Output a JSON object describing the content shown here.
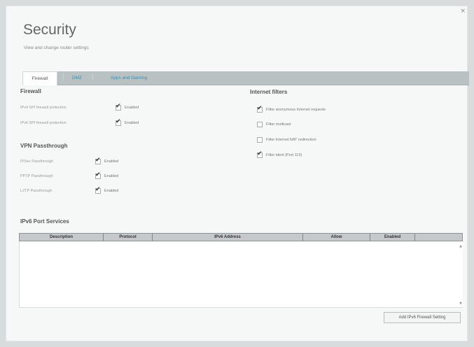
{
  "window": {
    "close_glyph": "×"
  },
  "page": {
    "title": "Security",
    "subtitle": "View and change router settings"
  },
  "tabs": [
    {
      "label": "Firewall",
      "active": true
    },
    {
      "label": "DMZ",
      "active": false
    },
    {
      "label": "Apps and Gaming",
      "active": false
    }
  ],
  "firewall": {
    "title": "Firewall",
    "rows": [
      {
        "label": "IPv4 SPI firewall protection",
        "checked": true,
        "text": "Enabled"
      },
      {
        "label": "IPv6 SPI firewall protection",
        "checked": true,
        "text": "Enabled"
      }
    ]
  },
  "vpn": {
    "title": "VPN Passthrough",
    "rows": [
      {
        "label": "IPSec Passthrough",
        "checked": true,
        "text": "Enabled"
      },
      {
        "label": "PPTP Passthrough",
        "checked": true,
        "text": "Enabled"
      },
      {
        "label": "L2TP Passthrough",
        "checked": true,
        "text": "Enabled"
      }
    ]
  },
  "internet_filters": {
    "title": "Internet filters",
    "rows": [
      {
        "text": "Filter anonymous Internet requests",
        "checked": true
      },
      {
        "text": "Filter multicast",
        "checked": false
      },
      {
        "text": "Filter Internet NAT redirection",
        "checked": false
      },
      {
        "text": "Filter ident (Port 113)",
        "checked": true
      }
    ]
  },
  "ipv6_ports": {
    "title": "IPv6 Port Services",
    "columns": [
      "Description",
      "Protocol",
      "IPv6 Address",
      "Allow",
      "Enabled"
    ],
    "rows": [],
    "add_button": "Add IPv6 Firewall Setting"
  },
  "icons": {
    "check": "check-icon",
    "close": "close-icon",
    "scroll_up": "scroll-up-icon",
    "scroll_down": "scroll-down-icon"
  }
}
